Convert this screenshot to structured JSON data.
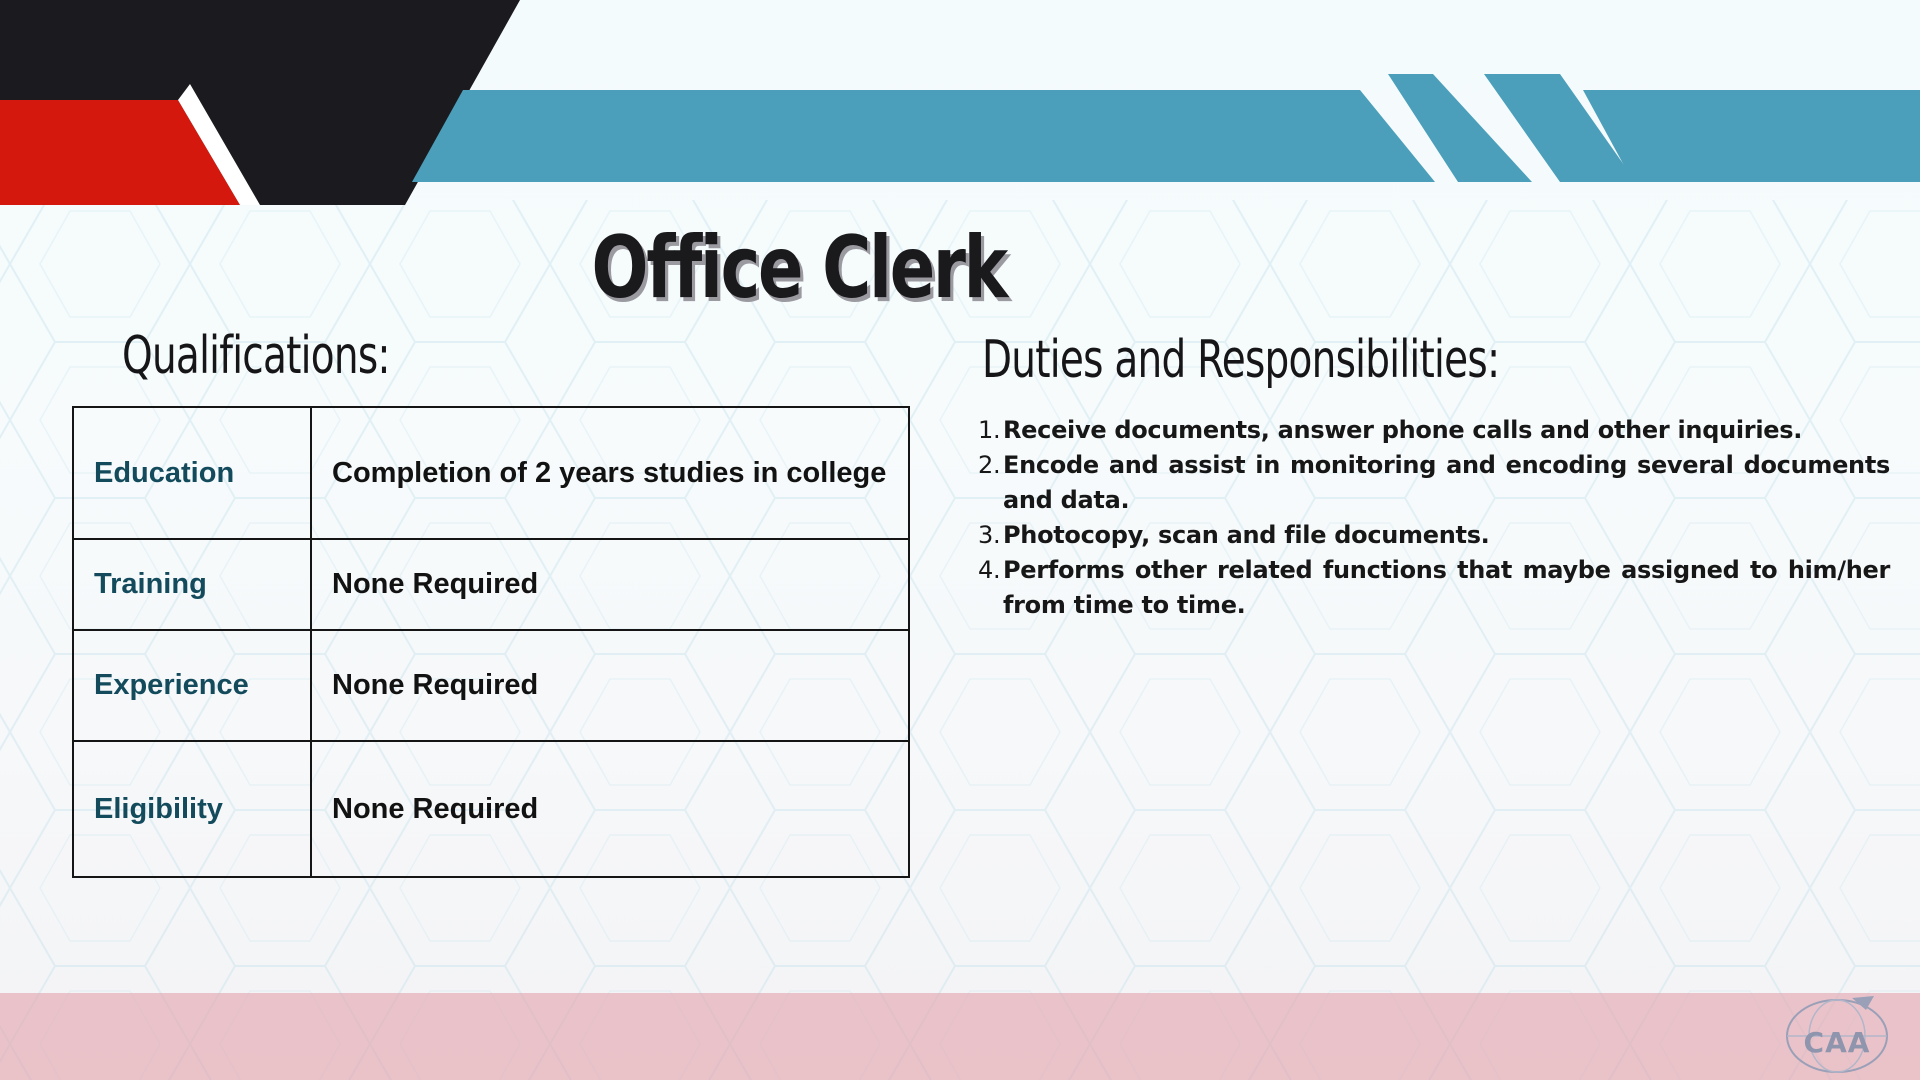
{
  "title": "Office Clerk",
  "qualifications": {
    "heading": "Qualifications:",
    "rows": [
      {
        "label": "Education",
        "value": "Completion of 2 years studies in college"
      },
      {
        "label": "Training",
        "value": "None Required"
      },
      {
        "label": "Experience",
        "value": "None Required"
      },
      {
        "label": "Eligibility",
        "value": "None Required"
      }
    ]
  },
  "duties": {
    "heading": "Duties and Responsibilities:",
    "items": [
      {
        "num": "1.",
        "text": "Receive documents, answer phone calls and other inquiries."
      },
      {
        "num": "2.",
        "text": "Encode and assist in monitoring and encoding several documents and data."
      },
      {
        "num": "3.",
        "text": "Photocopy, scan and file documents."
      },
      {
        "num": "4.",
        "text": "Performs other related functions that maybe assigned to him/her from time to time."
      }
    ]
  },
  "logo": {
    "text": "CAA",
    "icon": "caa-globe-logo-icon"
  },
  "colors": {
    "banner_black": "#1b1b1f",
    "banner_red": "#d4180d",
    "banner_blue": "#4b9fba",
    "label_teal": "#134b5c",
    "bottom_band": "#e4a5af"
  }
}
